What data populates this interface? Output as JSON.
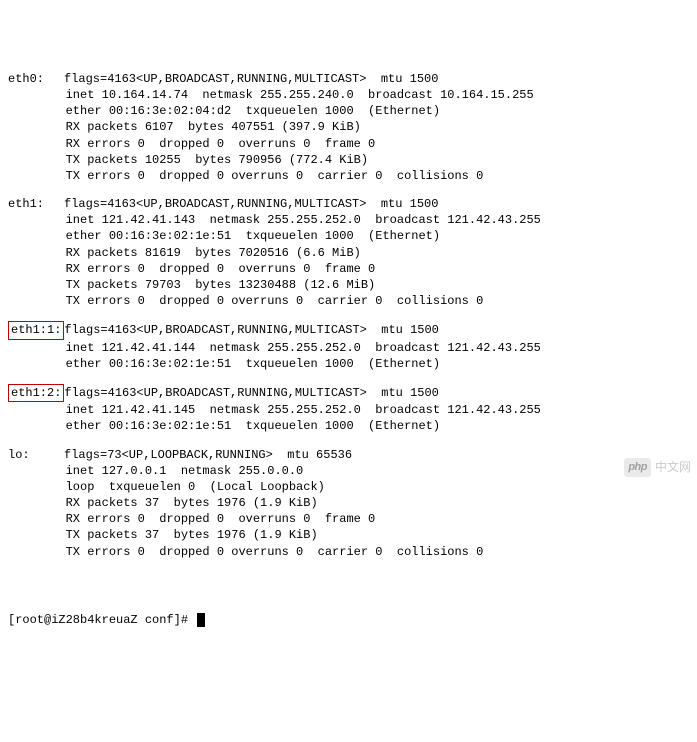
{
  "ifaces": [
    {
      "name": "eth0:",
      "boxed": false,
      "lines": [
        "flags=4163<UP,BROADCAST,RUNNING,MULTICAST>  mtu 1500",
        "inet 10.164.14.74  netmask 255.255.240.0  broadcast 10.164.15.255",
        "ether 00:16:3e:02:04:d2  txqueuelen 1000  (Ethernet)",
        "RX packets 6107  bytes 407551 (397.9 KiB)",
        "RX errors 0  dropped 0  overruns 0  frame 0",
        "TX packets 10255  bytes 790956 (772.4 KiB)",
        "TX errors 0  dropped 0 overruns 0  carrier 0  collisions 0"
      ]
    },
    {
      "name": "eth1:",
      "boxed": false,
      "lines": [
        "flags=4163<UP,BROADCAST,RUNNING,MULTICAST>  mtu 1500",
        "inet 121.42.41.143  netmask 255.255.252.0  broadcast 121.42.43.255",
        "ether 00:16:3e:02:1e:51  txqueuelen 1000  (Ethernet)",
        "RX packets 81619  bytes 7020516 (6.6 MiB)",
        "RX errors 0  dropped 0  overruns 0  frame 0",
        "TX packets 79703  bytes 13230488 (12.6 MiB)",
        "TX errors 0  dropped 0 overruns 0  carrier 0  collisions 0"
      ]
    },
    {
      "name": "eth1:1:",
      "boxed": true,
      "lines": [
        "flags=4163<UP,BROADCAST,RUNNING,MULTICAST>  mtu 1500",
        "inet 121.42.41.144  netmask 255.255.252.0  broadcast 121.42.43.255",
        "ether 00:16:3e:02:1e:51  txqueuelen 1000  (Ethernet)"
      ]
    },
    {
      "name": "eth1:2:",
      "boxed": true,
      "lines": [
        "flags=4163<UP,BROADCAST,RUNNING,MULTICAST>  mtu 1500",
        "inet 121.42.41.145  netmask 255.255.252.0  broadcast 121.42.43.255",
        "ether 00:16:3e:02:1e:51  txqueuelen 1000  (Ethernet)"
      ]
    },
    {
      "name": "lo:",
      "boxed": false,
      "lines": [
        "flags=73<UP,LOOPBACK,RUNNING>  mtu 65536",
        "inet 127.0.0.1  netmask 255.0.0.0",
        "loop  txqueuelen 0  (Local Loopback)",
        "RX packets 37  bytes 1976 (1.9 KiB)",
        "RX errors 0  dropped 0  overruns 0  frame 0",
        "TX packets 37  bytes 1976 (1.9 KiB)",
        "TX errors 0  dropped 0 overruns 0  carrier 0  collisions 0"
      ]
    }
  ],
  "prompt": "[root@iZ28b4kreuaZ conf]# ",
  "watermark": {
    "badge": "php",
    "text": "中文网"
  }
}
